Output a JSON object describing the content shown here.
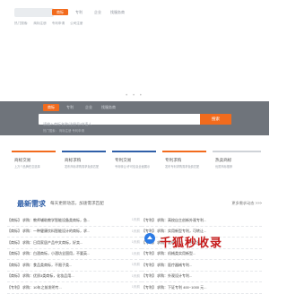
{
  "header": {
    "nav": [
      {
        "label": "商标",
        "active": true
      },
      {
        "label": "专利",
        "active": false
      },
      {
        "label": "企业",
        "active": false
      },
      {
        "label": "找服务商",
        "active": false
      }
    ],
    "subnav": [
      "热门搜索:",
      "商标注册",
      "专利申请",
      "公司注册"
    ]
  },
  "hero": {
    "tabs": [
      {
        "label": "商标",
        "active": true
      },
      {
        "label": "专利",
        "active": false
      },
      {
        "label": "企业",
        "active": false
      },
      {
        "label": "找服务商",
        "active": false
      }
    ],
    "search": {
      "placeholder": "请输入商标名称/注册号/申请人"
    },
    "search_button": "搜索",
    "hint": "热门搜索：  商标注册   专利申请"
  },
  "categories": [
    {
      "title": "商标交易",
      "subtitle": "上万个品牌任意选择",
      "accent": "#f26b1d"
    },
    {
      "title": "商标求购",
      "subtitle": "发布商标求购需求免费匹配",
      "accent": "#2f5fa8"
    },
    {
      "title": "专利交易",
      "subtitle": "专利转让/许可信息全面展示",
      "accent": "#2f5fa8"
    },
    {
      "title": "专利求购",
      "subtitle": "发布专利求购需求免费匹配",
      "accent": "#f26b1d"
    },
    {
      "title": "热卖商标",
      "subtitle": "优质商标推荐",
      "accent": "#cfd3d8"
    }
  ],
  "section": {
    "title": "最新需求",
    "subtitle": "每天更新动态，加速需求匹配",
    "more": "更多需求动态 >>>"
  },
  "left_list": [
    {
      "tag": "【商标】",
      "text": "求购：教师辅助教学智能设备类商标，急...",
      "date": "1天前"
    },
    {
      "tag": "【商标】",
      "text": "求购：一种健康饮料智能设计的商标，求...",
      "date": "1天前"
    },
    {
      "tag": "【商标】",
      "text": "求购：日用家居产品中文商标，好卖...",
      "date": "1天前"
    },
    {
      "tag": "【商标】",
      "text": "求购：白酒商标，小酒坊全国用，不要英...",
      "date": "1天前"
    },
    {
      "tag": "【商标】",
      "text": "求购：食品类商标，不限子类...",
      "date": "1天前"
    },
    {
      "tag": "【商标】",
      "text": "求购：优质3类商标，化妆品用...",
      "date": "1天前"
    },
    {
      "tag": "【专利】",
      "text": "求购：10年之前发明专...",
      "date": "1天前"
    }
  ],
  "right_list": [
    {
      "tag": "【专利】",
      "text": "求购：高校自主创新外观专利...",
      "date": ""
    },
    {
      "tag": "【专利】",
      "text": "求购：实用新型专利，可转让...",
      "date": ""
    },
    {
      "tag": "【专利】",
      "text": "求购：发明专利，电子信息类...",
      "date": ""
    },
    {
      "tag": "【专利】",
      "text": "求购：机械类实用新型...",
      "date": ""
    },
    {
      "tag": "【专利】",
      "text": "求购：医疗器械专利...",
      "date": ""
    },
    {
      "tag": "【专利】",
      "text": "求购：外观设计专利...",
      "date": ""
    },
    {
      "tag": "【专利】",
      "text": "求购：下证专利 400~1000 元...",
      "date": ""
    }
  ],
  "watermark": "千狐秒收录"
}
